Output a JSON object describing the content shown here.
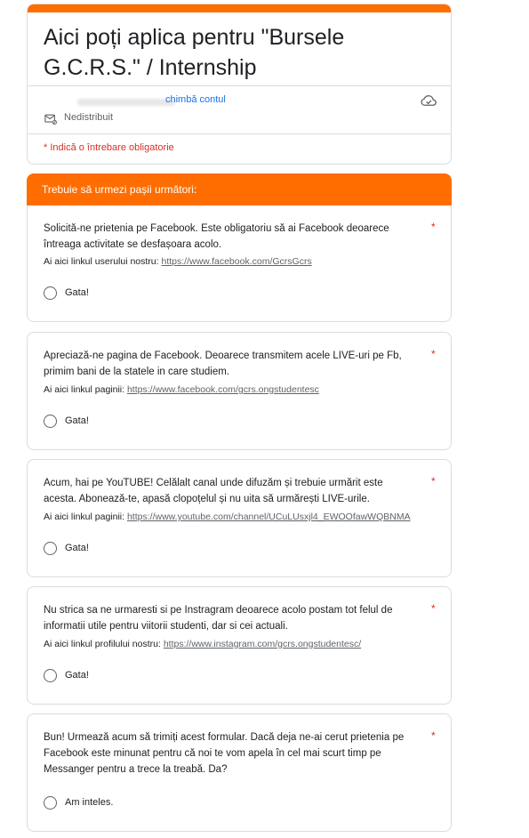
{
  "form": {
    "title": "Aici poți aplica pentru \"Bursele G.C.R.S.\" / Internship",
    "switch_account": "chimbă contul",
    "unshared_label": "Nedistribuit",
    "required_note": "* Indică o întrebare obligatorie",
    "accent": "#ff6d00"
  },
  "section": {
    "title": "Trebuie să urmezi pașii următori:"
  },
  "questions": [
    {
      "text": "Solicită-ne prietenia pe Facebook. Este obligatoriu să ai Facebook deoarece întreaga activitate se desfașoara acolo.",
      "link_prefix": "Ai aici linkul userului nostru: ",
      "link": "https://www.facebook.com/GcrsGcrs",
      "option": "Gata!",
      "required": "*"
    },
    {
      "text": "Apreciază-ne pagina de Facebook.  Deoarece transmitem acele LIVE-uri pe Fb, primim bani de la statele in care studiem.",
      "link_prefix": "Ai aici linkul paginii: ",
      "link": "https://www.facebook.com/gcrs.ongstudentesc",
      "option": "Gata!",
      "required": "*"
    },
    {
      "text": "Acum, hai pe YouTUBE! Celălalt canal unde difuzăm și trebuie urmărit este acesta. Abonează-te, apasă clopoțelul și nu uita să urmărești LIVE-urile.",
      "link_prefix": "Ai aici linkul paginii: ",
      "link": "https://www.youtube.com/channel/UCuLUsxjl4_EWOOfawWQBNMA",
      "option": "Gata!",
      "required": "*"
    },
    {
      "text": "Nu strica sa ne urmaresti si pe Instragram deoarece acolo postam tot felul de informatii utile pentru viitorii studenti, dar si cei actuali.",
      "link_prefix": "Ai aici linkul profilului nostru: ",
      "link": "https://www.instagram.com/gcrs.ongstudentesc/",
      "option": "Gata!",
      "required": "*"
    },
    {
      "text": "Bun! Urmează acum să trimiți acest formular. Dacă deja ne-ai cerut prietenia pe Facebook este minunat pentru că noi te vom apela în cel mai scurt timp pe Messanger pentru a trece la treabă. Da?",
      "option": "Am inteles.",
      "required": "*"
    }
  ]
}
